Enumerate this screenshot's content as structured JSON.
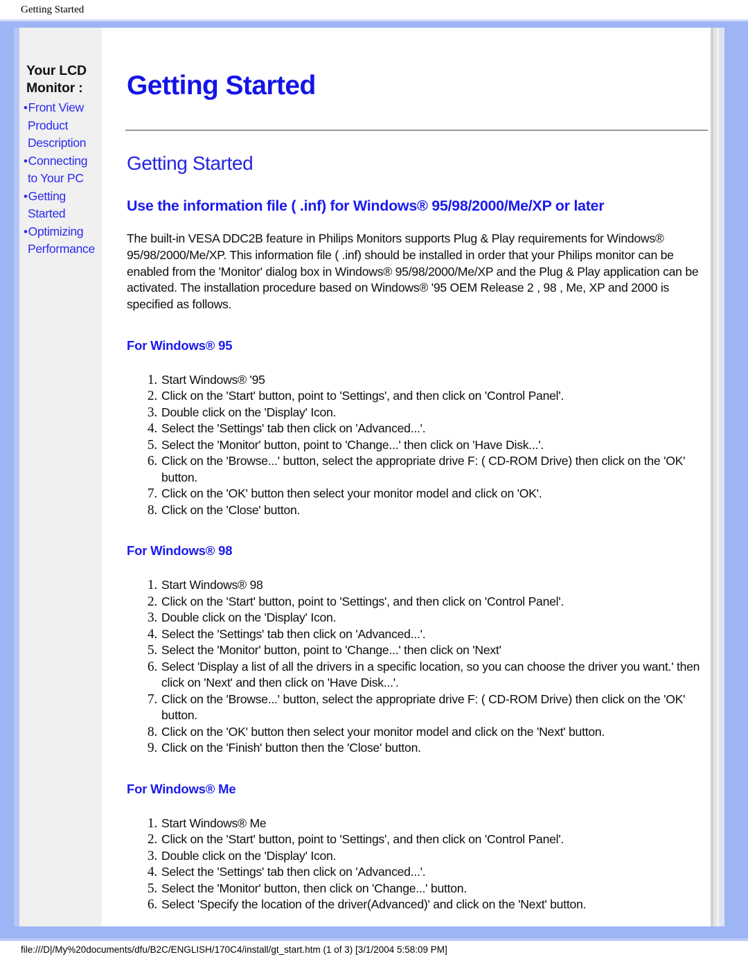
{
  "browser": {
    "header_title": "Getting Started",
    "footer_status": "file:///D|/My%20documents/dfu/B2C/ENGLISH/170C4/install/gt_start.htm (1 of 3) [3/1/2004 5:58:09 PM]"
  },
  "colors": {
    "frame_blue": "#9db4f5",
    "link_blue": "#2a2aee",
    "heading_blue": "#1414e6",
    "subheading_blue": "#2424e0",
    "sidebar_bg": "#f0f0f0"
  },
  "sidebar": {
    "title": "Your LCD Monitor :",
    "items": [
      {
        "bullet": "•",
        "line1": "Front View",
        "line2": "Product",
        "line3": "Description"
      },
      {
        "bullet": "•",
        "line1": "Connecting",
        "line2": "to Your PC",
        "line3": ""
      },
      {
        "bullet": "•",
        "line1": "Getting",
        "line2": "Started",
        "line3": ""
      },
      {
        "bullet": "•",
        "line1": "Optimizing",
        "line2": "Performance",
        "line3": ""
      }
    ]
  },
  "main": {
    "page_title": "Getting Started",
    "section_title": "Getting Started",
    "subsection_title": "Use the information file ( .inf) for Windows® 95/98/2000/Me/XP or later",
    "intro_paragraph": "The built-in VESA DDC2B feature in Philips Monitors supports Plug & Play requirements for Windows® 95/98/2000/Me/XP. This information file ( .inf) should be installed in order that your Philips monitor can be enabled from the 'Monitor' dialog box in Windows® 95/98/2000/Me/XP and the Plug & Play application can be activated. The installation procedure based on Windows® '95 OEM Release 2 , 98 , Me, XP and 2000 is specified as follows.",
    "groups": [
      {
        "title": "For Windows® 95",
        "steps": [
          "Start Windows® '95",
          "Click on the 'Start' button, point to 'Settings', and then click on 'Control Panel'.",
          "Double click on the 'Display' Icon.",
          "Select the 'Settings' tab then click on 'Advanced...'.",
          "Select the 'Monitor' button, point to 'Change...' then click on 'Have Disk...'.",
          "Click on the 'Browse...' button, select the appropriate drive F: ( CD-ROM Drive) then click on the 'OK' button.",
          "Click on the 'OK' button then select your monitor model and click on 'OK'.",
          "Click on the 'Close' button."
        ]
      },
      {
        "title": "For Windows® 98",
        "steps": [
          "Start Windows® 98",
          "Click on the 'Start' button, point to 'Settings', and then click on 'Control Panel'.",
          "Double click on the 'Display' Icon.",
          "Select the 'Settings' tab then click on 'Advanced...'.",
          "Select the 'Monitor' button, point to 'Change...' then click on 'Next'",
          "Select 'Display a list of all the drivers in a specific location, so you can choose the driver you want.' then click on 'Next' and then click on 'Have Disk...'.",
          "Click on the 'Browse...' button, select the appropriate drive F: ( CD-ROM Drive) then click on the 'OK' button.",
          "Click on the 'OK' button then select your monitor model and click on the 'Next' button.",
          "Click on the 'Finish' button then the 'Close' button."
        ]
      },
      {
        "title": "For Windows® Me",
        "steps": [
          "Start Windows® Me",
          "Click on the 'Start' button, point to 'Settings', and then click on 'Control Panel'.",
          "Double click on the 'Display' Icon.",
          "Select the 'Settings' tab then click on 'Advanced...'.",
          "Select the 'Monitor' button, then click on 'Change...' button.",
          "Select 'Specify the location of the driver(Advanced)' and click on the 'Next' button."
        ]
      }
    ]
  }
}
